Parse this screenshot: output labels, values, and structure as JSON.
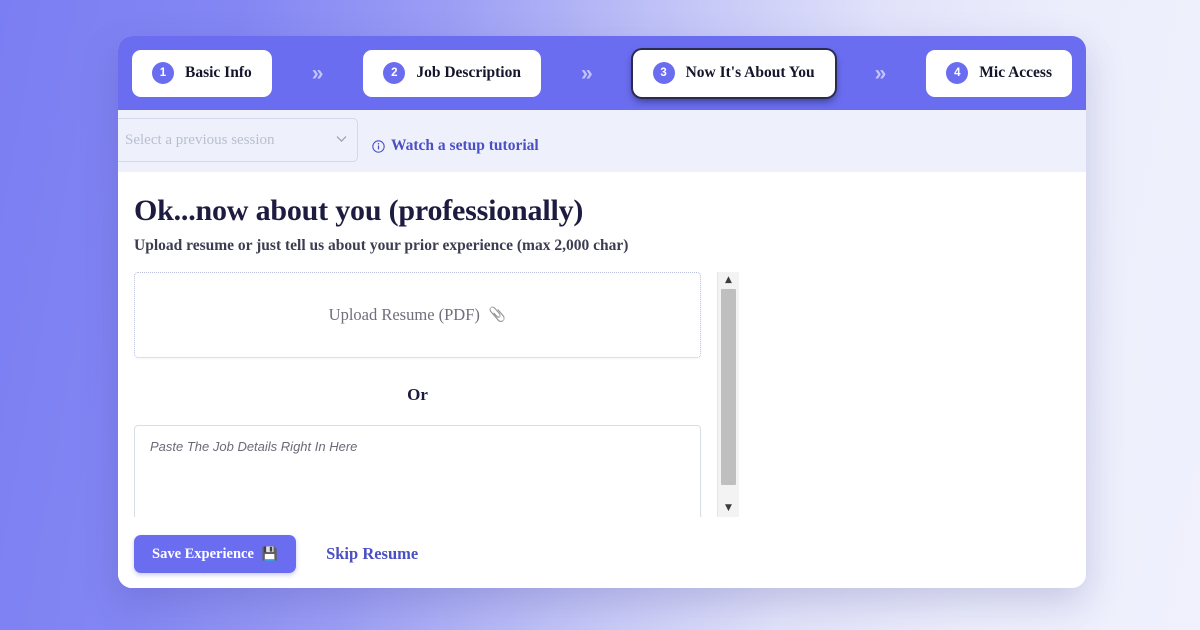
{
  "theme": {
    "brand": "#6a6df0",
    "brand_dark": "#4b4fc4",
    "page_bg_left": "#7b7ef2",
    "page_bg_right": "#f0f1fd",
    "subbar_bg": "#eef1fb",
    "title_color": "#1d1b3f"
  },
  "stepper": {
    "steps": [
      {
        "number": "1",
        "label": "Basic Info",
        "active": false
      },
      {
        "number": "2",
        "label": "Job Description",
        "active": false
      },
      {
        "number": "3",
        "label": "Now It's About You",
        "active": true
      },
      {
        "number": "4",
        "label": "Mic Access",
        "active": false
      }
    ],
    "separator": "»"
  },
  "subbar": {
    "session_select": {
      "value": "",
      "placeholder": "Select a previous session",
      "caret": "⌄"
    },
    "tutorial": {
      "icon": "info-circle-icon",
      "label": "Watch a setup tutorial"
    }
  },
  "main": {
    "title": "Ok...now about you (professionally)",
    "subtitle": "Upload resume or just tell us about your prior experience (max 2,000 char)",
    "upload": {
      "label": "Upload Resume (PDF)",
      "icon": "📎"
    },
    "or_label": "Or",
    "details": {
      "value": "",
      "placeholder": "Paste The Job Details Right In Here"
    },
    "scrollbar": {
      "up_arrow": "▲",
      "down_arrow": "▼"
    }
  },
  "actions": {
    "save_label": "Save Experience",
    "save_icon": "💾",
    "skip_label": "Skip Resume"
  }
}
